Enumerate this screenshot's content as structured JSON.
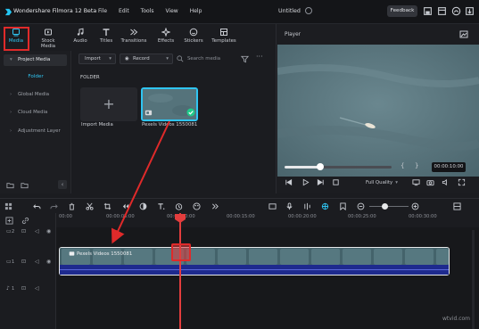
{
  "app": {
    "name": "Wondershare Filmora 12 Beta",
    "document_title": "Untitled"
  },
  "menu": [
    "File",
    "Edit",
    "Tools",
    "View",
    "Help"
  ],
  "titlebar": {
    "feedback_label": "Feedback"
  },
  "media_tabs": [
    {
      "label": "Media",
      "icon": "media-icon",
      "active": true
    },
    {
      "label": "Stock Media",
      "icon": "stock-media-icon"
    },
    {
      "label": "Audio",
      "icon": "audio-icon"
    },
    {
      "label": "Titles",
      "icon": "titles-icon"
    },
    {
      "label": "Transitions",
      "icon": "transitions-icon"
    },
    {
      "label": "Effects",
      "icon": "effects-icon"
    },
    {
      "label": "Stickers",
      "icon": "stickers-icon"
    },
    {
      "label": "Templates",
      "icon": "templates-icon"
    }
  ],
  "sidebar": {
    "items": [
      {
        "label": "Project Media",
        "selected": true
      },
      {
        "label": "Folder",
        "is_folder": true
      },
      {
        "label": "Global Media"
      },
      {
        "label": "Cloud Media"
      },
      {
        "label": "Adjustment Layer"
      }
    ]
  },
  "media_browser": {
    "import_label": "Import",
    "record_label": "Record",
    "search_placeholder": "Search media",
    "folder_header": "FOLDER",
    "tiles": [
      {
        "label": "Import Media",
        "type": "import"
      },
      {
        "label": "Pexels Videos 1550081",
        "type": "video",
        "selected": true
      }
    ]
  },
  "player": {
    "title": "Player",
    "time": "00:00:10:00",
    "quality_label": "Full Quality",
    "progress_fraction": 0.33
  },
  "timeline": {
    "ruler_ticks": [
      "00:00",
      "00:00:05:00",
      "00:00:10:00",
      "00:00:15:00",
      "00:00:20:00",
      "00:00:25:00",
      "00:00:30:00"
    ],
    "track_labels": {
      "video2": "2",
      "video1": "1",
      "audio1": "1"
    },
    "clip_label": "Pexels Videos 1550081"
  },
  "watermark": "wtvid.com",
  "colors": {
    "accent": "#2fc5f2",
    "annotation_red": "#e02a2a",
    "playhead": "#e33d3d",
    "audio_wave": "#1e2a8e"
  }
}
